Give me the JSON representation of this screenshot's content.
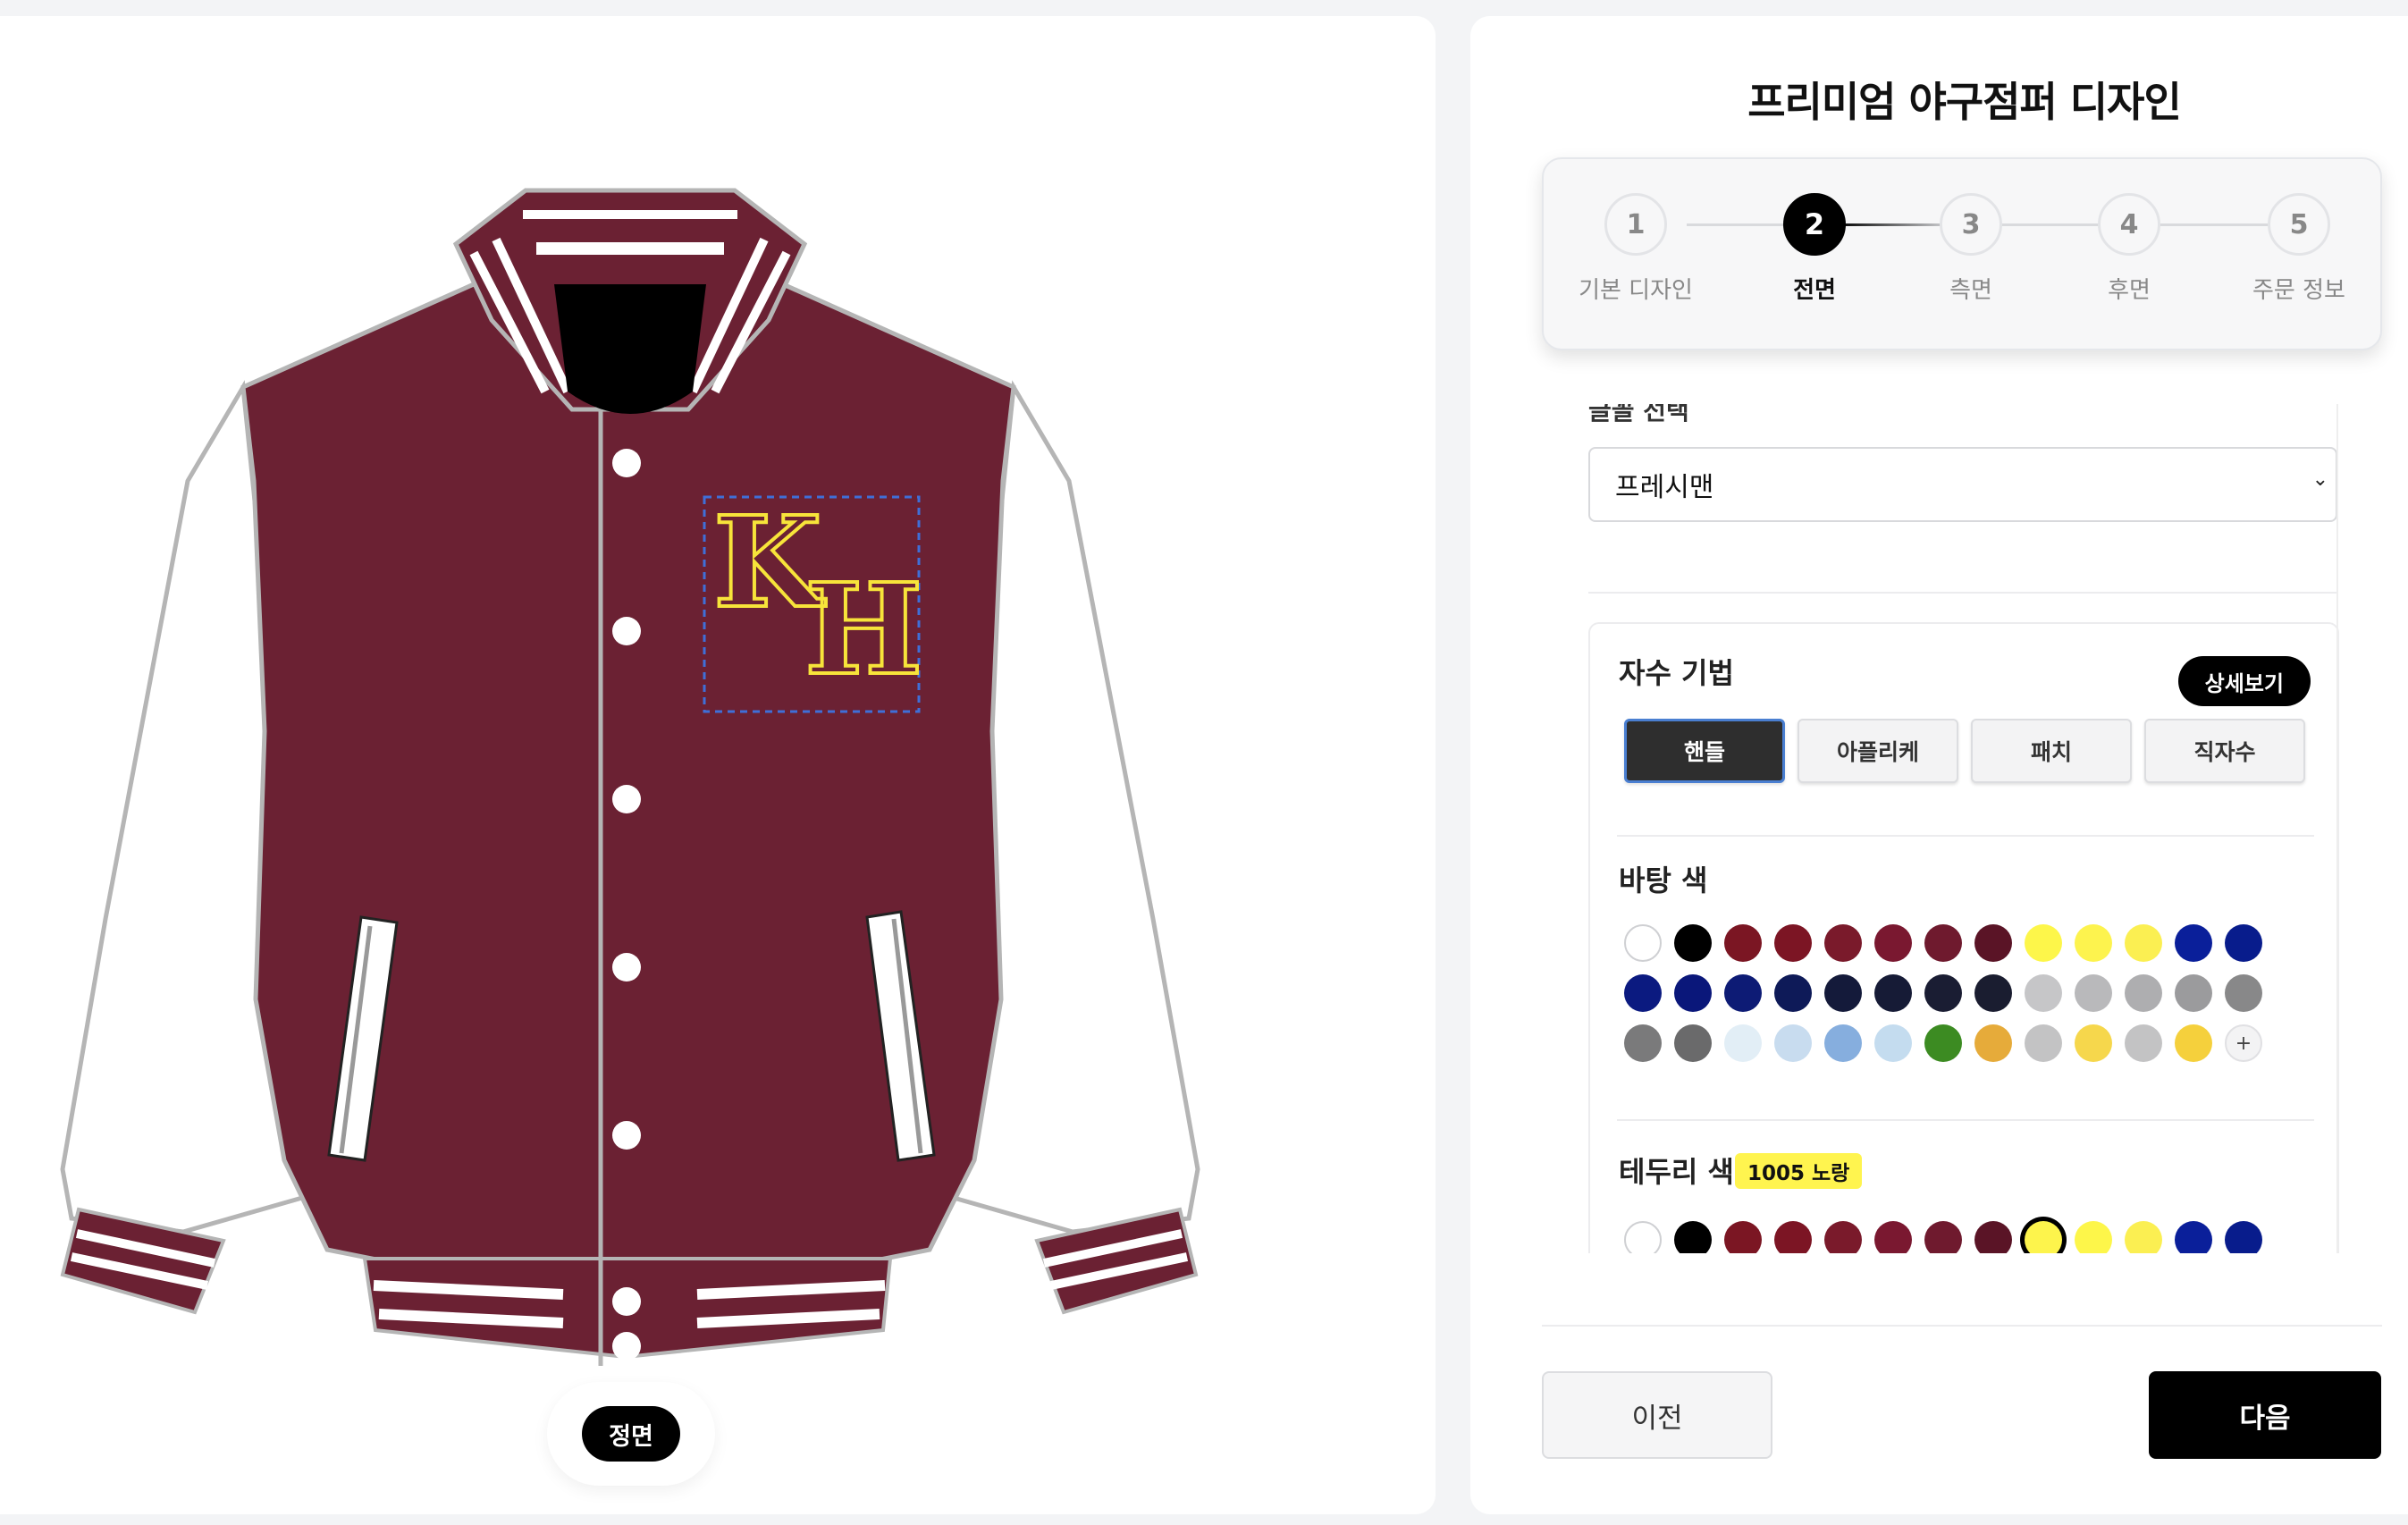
{
  "title": "프리미엄 야구점퍼 디자인",
  "preview": {
    "view_label": "정면",
    "monogram": "KH",
    "body_color": "#6b2133",
    "sleeve_color": "#ffffff",
    "monogram_color": "#f7e43a"
  },
  "stepper": {
    "steps": [
      {
        "number": "1",
        "label": "기본 디자인"
      },
      {
        "number": "2",
        "label": "전면"
      },
      {
        "number": "3",
        "label": "측면"
      },
      {
        "number": "4",
        "label": "후면"
      },
      {
        "number": "5",
        "label": "주문 정보"
      }
    ],
    "active_step": "2"
  },
  "font": {
    "label": "글꼴 선택",
    "selected": "프레시맨"
  },
  "embroidery": {
    "title": "자수 기법",
    "detail_button": "상세보기",
    "techniques": [
      "핸들",
      "아플리케",
      "패치",
      "직자수"
    ],
    "selected_technique": "핸들"
  },
  "base_color": {
    "title": "바탕 색",
    "swatches": [
      "#ffffff",
      "#000000",
      "#7b1623",
      "#7c1524",
      "#7a1a2b",
      "#7a1830",
      "#6f1a2e",
      "#5a1426",
      "#fdf64a",
      "#fdf34e",
      "#fbef52",
      "#0a1f9a",
      "#081c8c",
      "#0b1a80",
      "#0a177a",
      "#0d1b75",
      "#0e1a58",
      "#141a3a",
      "#161b36",
      "#1a1d33",
      "#1a1d30",
      "#c6c6c8",
      "#b9b9bb",
      "#aeaeb0",
      "#9b9b9d",
      "#888889",
      "#7a7a7b",
      "#6a6a6b",
      "#e2eef6",
      "#c8dcef",
      "#86aede",
      "#c4dcef",
      "#3c8b22",
      "#e6ab3a",
      "#c3c3c4",
      "#f6d74c",
      "#c3c3c4",
      "#f5d03c"
    ],
    "plus_label": "+"
  },
  "border_color": {
    "title": "테두리 색",
    "badge": "1005 노랑",
    "swatches": [
      "#ffffff",
      "#000000",
      "#7b1623",
      "#7c1524",
      "#7a1a2b",
      "#7a1830",
      "#6f1a2e",
      "#5a1426",
      "#fdf44c",
      "#fdf64a",
      "#fbef52",
      "#0a1f9a",
      "#081c8c"
    ],
    "selected_index": "8"
  },
  "footer": {
    "prev": "이전",
    "next": "다음"
  }
}
